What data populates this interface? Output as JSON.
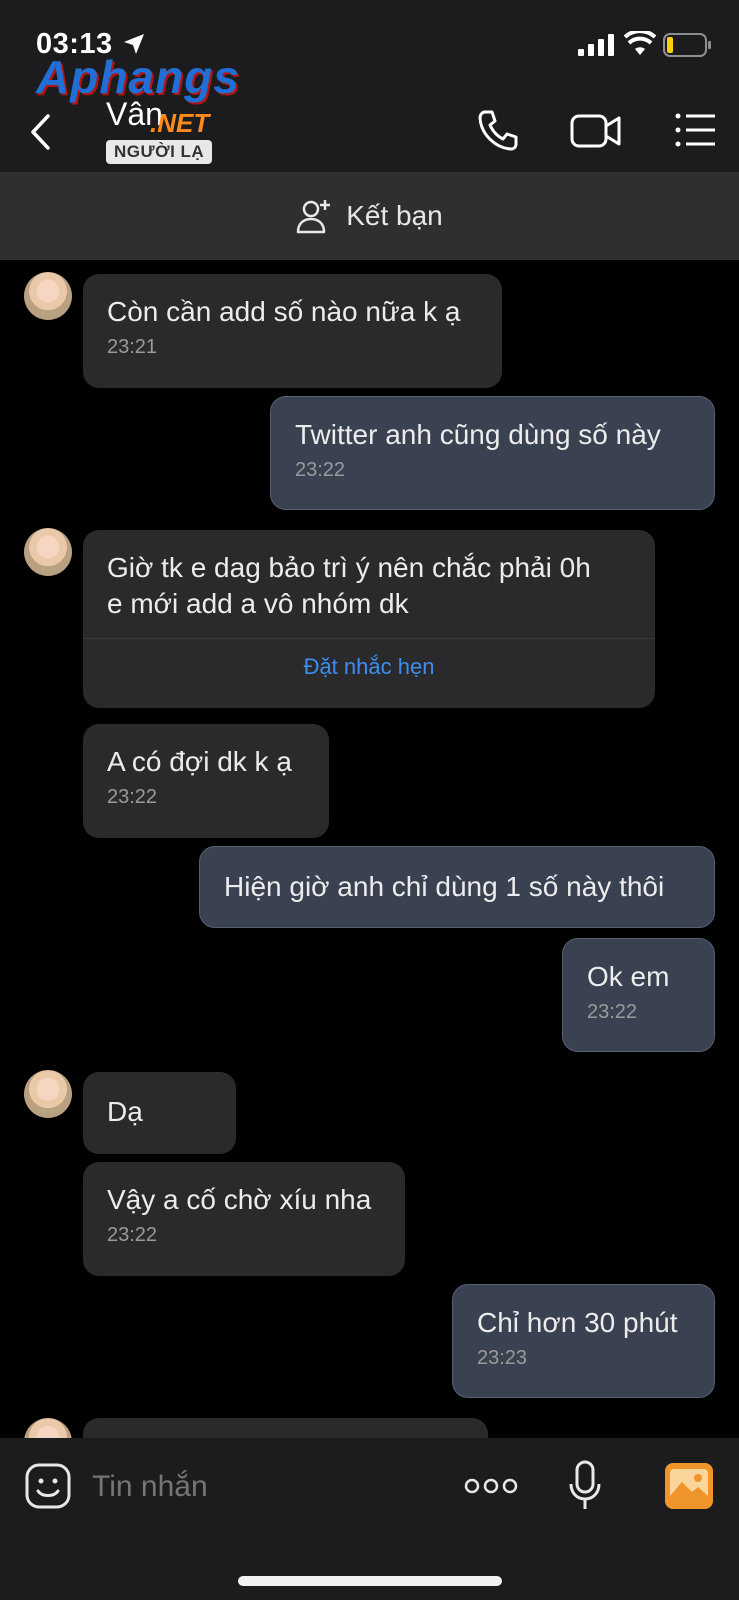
{
  "status": {
    "time": "03:13"
  },
  "header": {
    "contact_name": "Vân",
    "badge": "NGƯỜI LẠ",
    "watermark_main": "Aphangs",
    "watermark_sub": ".NET"
  },
  "add_friend": {
    "label": "Kết bạn"
  },
  "messages": [
    {
      "text": "Còn cần add số nào nữa k ạ",
      "time": "23:21"
    },
    {
      "text": "Twitter anh cũng dùng số này",
      "time": "23:22"
    },
    {
      "text_line1": "Giờ tk e dag bảo trì ý nên chắc phải 0h",
      "text_line2": "e mới add a vô nhóm dk",
      "action": "Đặt nhắc hẹn"
    },
    {
      "text": "A có đợi dk k ạ",
      "time": "23:22"
    },
    {
      "text": "Hiện giờ anh chỉ dùng 1 số này thôi"
    },
    {
      "text": "Ok em",
      "time": "23:22"
    },
    {
      "text": "Dạ"
    },
    {
      "text": "Vậy a cố chờ xíu nha",
      "time": "23:22"
    },
    {
      "text": "Chỉ hơn 30 phút",
      "time": "23:23"
    }
  ],
  "composer": {
    "placeholder": "Tin nhắn"
  },
  "colors": {
    "accent": "#3d8ef0",
    "outgoing_bubble": "#3a4150",
    "incoming_bubble": "#2a2a2c",
    "image_button": "#f0942c"
  }
}
